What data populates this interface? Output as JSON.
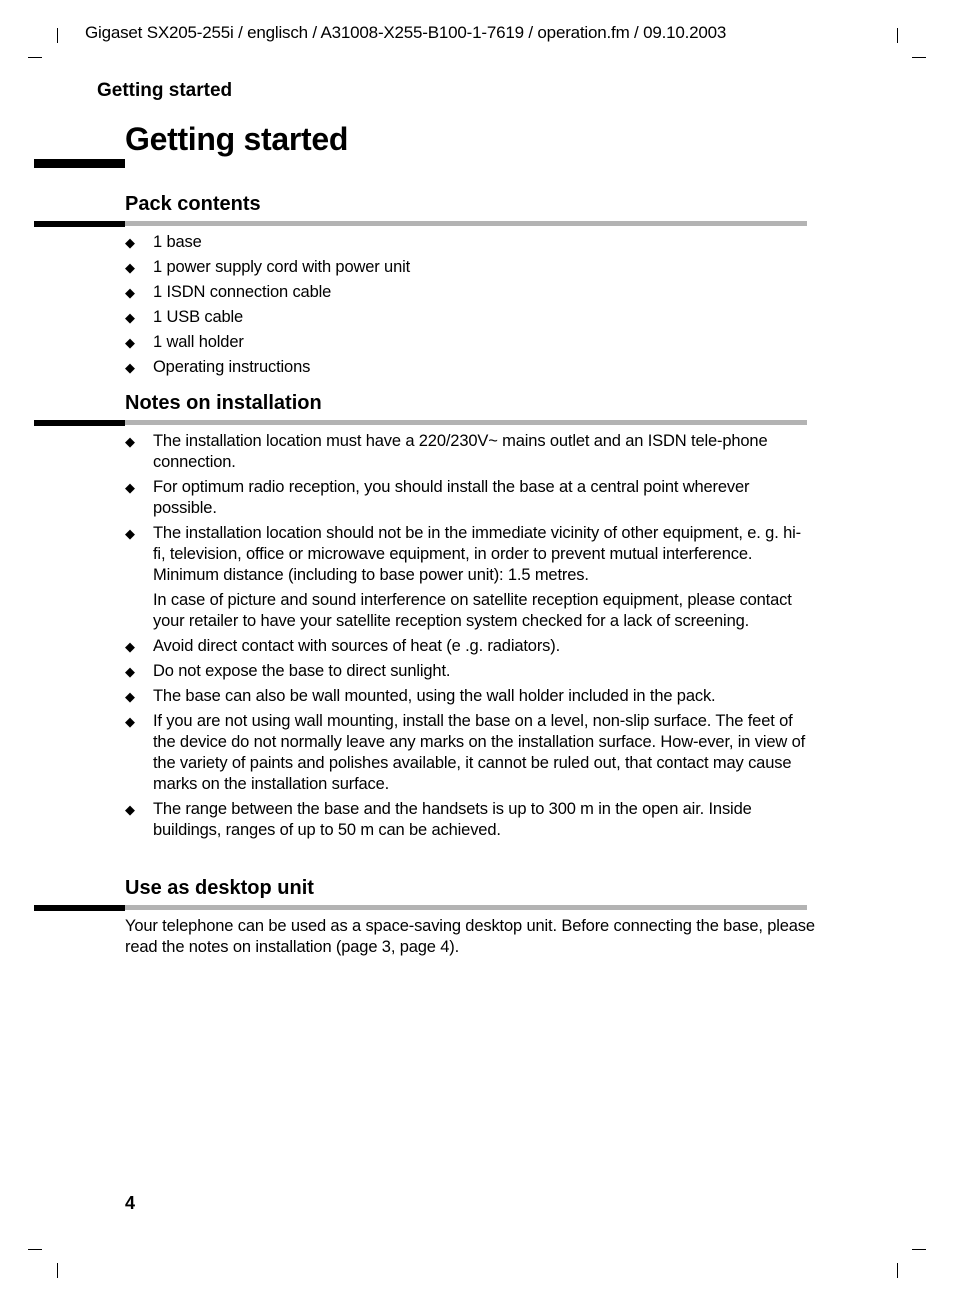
{
  "header": {
    "meta": "Gigaset SX205-255i / englisch / A31008-X255-B100-1-7619 / operation.fm / 09.10.2003",
    "running_head": "Getting started"
  },
  "chapter": {
    "title": "Getting started"
  },
  "sections": {
    "pack_contents": {
      "title": "Pack contents",
      "items": [
        "1 base",
        "1 power supply cord with power unit",
        "1 ISDN connection cable",
        "1 USB cable",
        "1 wall holder",
        "Operating instructions"
      ]
    },
    "notes_on_installation": {
      "title": "Notes on installation",
      "items": [
        {
          "text": "The installation location must have a 220/230V~ mains outlet and an ISDN tele-phone connection."
        },
        {
          "text": "For optimum radio reception, you should install the base at a central point wherever possible."
        },
        {
          "text": "The installation location should not be in the immediate vicinity of other equipment, e. g. hi-fi, television, office or microwave equipment, in order to prevent mutual interference. Minimum distance (including to base power unit): 1.5 metres.",
          "extra": "In case of picture and sound interference on satellite reception equipment, please contact your retailer to have your satellite reception system checked for a lack of screening."
        },
        {
          "text": "Avoid direct contact with sources of heat (e .g. radiators)."
        },
        {
          "text": "Do not expose the base to direct sunlight."
        },
        {
          "text": "The base can also be wall mounted, using the wall holder included in the pack."
        },
        {
          "text": "If you are not using wall mounting, install the base on a level, non-slip surface. The feet of the device do not normally leave any marks on the installation surface. How-ever, in view of the variety of paints and polishes available, it cannot be ruled out, that contact may cause marks on the installation surface."
        },
        {
          "text": "The range between the base and the handsets is up to 300 m in the open air. Inside buildings, ranges of up to 50 m can be achieved."
        }
      ]
    },
    "desktop_unit": {
      "title": "Use as desktop unit",
      "paragraph": "Your telephone can be used as a space-saving desktop unit. Before connecting the base, please read the notes on installation (page 3, page 4)."
    }
  },
  "bullet_glyph": "◆",
  "footer": {
    "page_number": "4"
  }
}
